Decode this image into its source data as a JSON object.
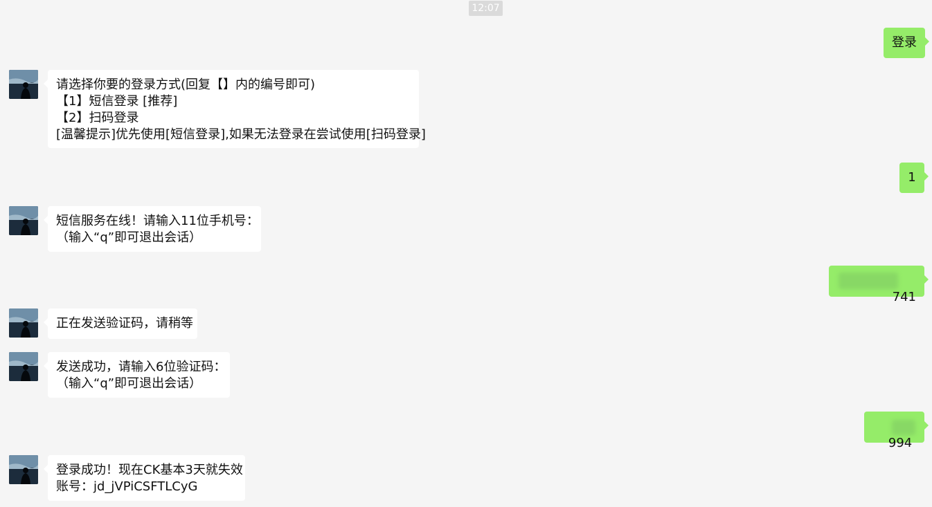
{
  "timestamp": "12:07",
  "contact": {
    "avatar_icon": "seaside-silhouette-avatar"
  },
  "messages": [
    {
      "dir": "out",
      "text": "登录"
    },
    {
      "dir": "in",
      "text": "请选择你要的登录方式(回复【】内的编号即可)\n【1】短信登录 [推荐]\n【2】扫码登录\n[温馨提示]优先使用[短信登录],如果无法登录在尝试使用[扫码登录]"
    },
    {
      "dir": "out",
      "text": "1"
    },
    {
      "dir": "in",
      "text": "短信服务在线！请输入11位手机号：\n（输入“q”即可退出会话）"
    },
    {
      "dir": "out",
      "text": "741",
      "redacted": true
    },
    {
      "dir": "in",
      "text": "正在发送验证码，请稍等"
    },
    {
      "dir": "in",
      "text": "发送成功，请输入6位验证码：\n（输入“q”即可退出会话）"
    },
    {
      "dir": "out",
      "text": "994",
      "redacted": true
    },
    {
      "dir": "in",
      "text": "登录成功！现在CK基本3天就失效\n账号：jd_jVPiCSFTLCyG"
    }
  ],
  "colors": {
    "background": "#f5f5f5",
    "incoming_bubble": "#ffffff",
    "outgoing_bubble": "#95ec69"
  }
}
